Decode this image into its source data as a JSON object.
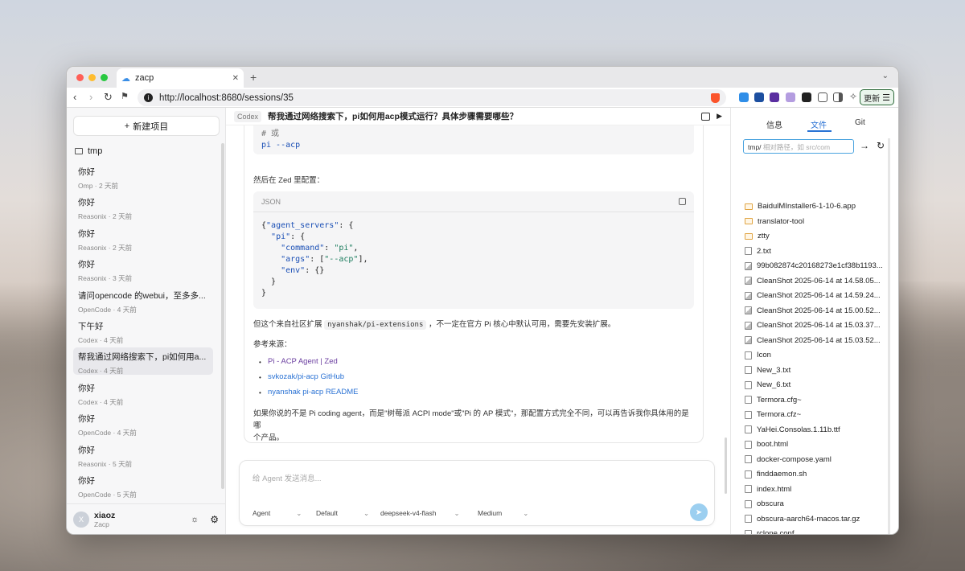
{
  "browser": {
    "tab_title": "zacp",
    "url": "http://localhost:8680/sessions/35",
    "update_label": "更新"
  },
  "sidebar": {
    "new_project": "新建项目",
    "folder": "tmp",
    "sessions": [
      {
        "title": "你好",
        "meta": "Omp · 2 天前"
      },
      {
        "title": "你好",
        "meta": "Reasonix · 2 天前"
      },
      {
        "title": "你好",
        "meta": "Reasonix · 2 天前"
      },
      {
        "title": "你好",
        "meta": "Reasonix · 3 天前"
      },
      {
        "title": "请问opencode 的webui，至多多...",
        "meta": "OpenCode · 4 天前"
      },
      {
        "title": "下午好",
        "meta": "Codex · 4 天前"
      },
      {
        "title": "帮我通过网络搜索下，pi如何用a...",
        "meta": "Codex · 4 天前"
      },
      {
        "title": "你好",
        "meta": "Codex · 4 天前"
      },
      {
        "title": "你好",
        "meta": "OpenCode · 4 天前"
      },
      {
        "title": "你好",
        "meta": "Reasonix · 5 天前"
      },
      {
        "title": "你好",
        "meta": "OpenCode · 5 天前"
      }
    ],
    "user": {
      "initial": "X",
      "name": "xiaoz",
      "sub": "Zacp"
    }
  },
  "main": {
    "agent_tag": "Codex",
    "title": "帮我通过网络搜索下，pi如何用acp模式运行？具体步骤需要哪些？",
    "code1": {
      "comment": "# 或",
      "cmd": "pi --acp"
    },
    "text1": "然后在 Zed 里配置：",
    "code2": {
      "lang": "JSON",
      "l1k": "\"agent_servers\"",
      "l2k": "\"pi\"",
      "l3k": "\"command\"",
      "l3v": "\"pi\"",
      "l4k": "\"args\"",
      "l4v": "\"--acp\"",
      "l5k": "\"env\""
    },
    "text2a": "但这个来自社区扩展",
    "text2code": "nyanshak/pi-extensions",
    "text2b": "，不一定在官方 Pi 核心中默认可用，需要先安装扩展。",
    "text3": "参考来源：",
    "links": [
      "Pi - ACP Agent | Zed",
      "svkozak/pi-acp GitHub",
      "nyanshak pi-acp README"
    ],
    "text4a": "如果你说的不是 Pi coding agent，而是\"树莓派 ACPI mode\"或\"Pi 的 AP 模式\"，那配置方式完全不同，可以再告诉我你具体用的是哪",
    "text4b": "个产品。"
  },
  "composer": {
    "placeholder": "给 Agent 发送消息...",
    "agent": "Agent",
    "mode": "Default",
    "model": "deepseek-v4-flash",
    "effort": "Medium"
  },
  "rpanel": {
    "tabs": [
      "信息",
      "文件",
      "Git"
    ],
    "path_prefix": "tmp/",
    "path_placeholder": "相对路径，如 src/com",
    "files": [
      {
        "name": "BaidulMInstaller6-1-10-6.app",
        "type": "folder"
      },
      {
        "name": "translator-tool",
        "type": "folder"
      },
      {
        "name": "ztty",
        "type": "folder"
      },
      {
        "name": "2.txt",
        "type": "file"
      },
      {
        "name": "99b082874c20168273e1cf38b1193...",
        "type": "image"
      },
      {
        "name": "CleanShot 2025-06-14 at 14.58.05...",
        "type": "image"
      },
      {
        "name": "CleanShot 2025-06-14 at 14.59.24...",
        "type": "image"
      },
      {
        "name": "CleanShot 2025-06-14 at 15.00.52...",
        "type": "image"
      },
      {
        "name": "CleanShot 2025-06-14 at 15.03.37...",
        "type": "image"
      },
      {
        "name": "CleanShot 2025-06-14 at 15.03.52...",
        "type": "image"
      },
      {
        "name": "Icon",
        "type": "file"
      },
      {
        "name": "New_3.txt",
        "type": "file"
      },
      {
        "name": "New_6.txt",
        "type": "file"
      },
      {
        "name": "Termora.cfg~",
        "type": "file"
      },
      {
        "name": "Termora.cfz~",
        "type": "file"
      },
      {
        "name": "YaHei.Consolas.1.11b.ttf",
        "type": "file"
      },
      {
        "name": "boot.html",
        "type": "file"
      },
      {
        "name": "docker-compose.yaml",
        "type": "file"
      },
      {
        "name": "finddaemon.sh",
        "type": "file"
      },
      {
        "name": "index.html",
        "type": "file"
      },
      {
        "name": "obscura",
        "type": "file"
      },
      {
        "name": "obscura-aarch64-macos.tar.gz",
        "type": "file"
      },
      {
        "name": "rclone.conf",
        "type": "file"
      }
    ]
  },
  "colors": {
    "accent": "#2a72d4",
    "link": "#2a72d4",
    "visited_link": "#6b3fa0",
    "send": "#9ccff0"
  }
}
